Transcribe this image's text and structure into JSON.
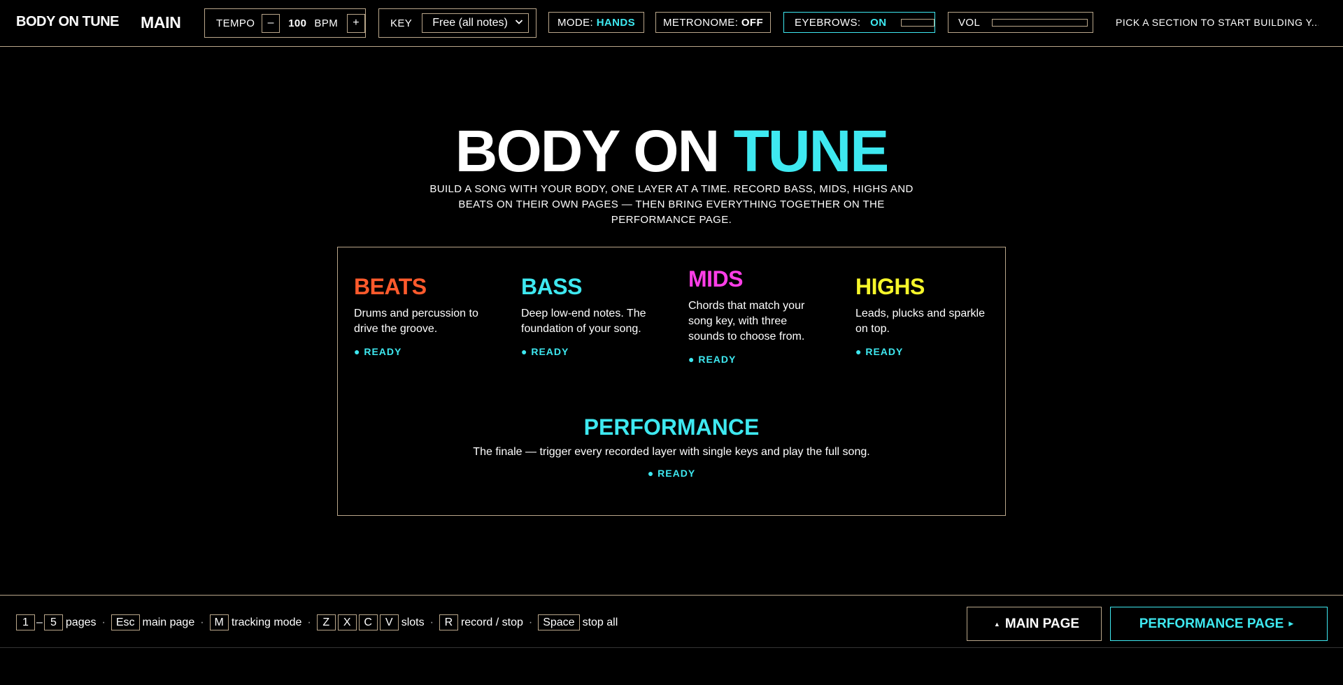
{
  "brand": "BODY ON TUNE",
  "page_name": "MAIN",
  "tempo": {
    "label": "TEMPO",
    "minus": "–",
    "value": "100",
    "unit": "BPM",
    "plus": "+"
  },
  "key": {
    "label": "KEY",
    "selected": "Free (all notes)"
  },
  "mode": {
    "label": "MODE:",
    "value": "HANDS"
  },
  "metronome": {
    "label": "METRONOME:",
    "value": "OFF"
  },
  "eyebrows": {
    "label": "EYEBROWS:",
    "value": "ON"
  },
  "volume": {
    "label": "VOL"
  },
  "status_text": "PICK A SECTION TO START BUILDING Y...",
  "hero": {
    "title_part1": "BODY ON",
    "title_part2": "TUNE",
    "subtitle": "BUILD A SONG WITH YOUR BODY, ONE LAYER AT A TIME. RECORD BASS, MIDS, HIGHS AND BEATS ON THEIR OWN PAGES — THEN BRING EVERYTHING TOGETHER ON THE PERFORMANCE PAGE."
  },
  "sections": [
    {
      "name": "BEATS",
      "color": "#ff5a2c",
      "desc": "Drums and percussion to drive the groove.",
      "status": "● READY"
    },
    {
      "name": "BASS",
      "color": "#3ee8f0",
      "desc": "Deep low-end notes. The foundation of your song.",
      "status": "● READY"
    },
    {
      "name": "MIDS",
      "color": "#ff3ee8",
      "desc": "Chords that match your song key, with three sounds to choose from.",
      "status": "● READY"
    },
    {
      "name": "HIGHS",
      "color": "#f6f62a",
      "desc": "Leads, plucks and sparkle on top.",
      "status": "● READY"
    }
  ],
  "performance": {
    "name": "PERFORMANCE",
    "desc": "The finale — trigger every recorded layer with single keys and play the full song.",
    "status": "● READY"
  },
  "shortcuts": {
    "k1": "1",
    "dash": "–",
    "k5": "5",
    "pages": "pages",
    "esc": "Esc",
    "main_page": "main page",
    "m": "M",
    "tracking": "tracking mode",
    "z": "Z",
    "x": "X",
    "c": "C",
    "v": "V",
    "slots": "slots",
    "r": "R",
    "record": "record / stop",
    "space": "Space",
    "stop_all": "stop all",
    "dot": "·"
  },
  "buttons": {
    "main_page": "MAIN PAGE",
    "performance_page": "PERFORMANCE PAGE"
  },
  "colors": {
    "accent": "#3ee8f0",
    "border": "#b9a68a",
    "background": "#000000"
  }
}
